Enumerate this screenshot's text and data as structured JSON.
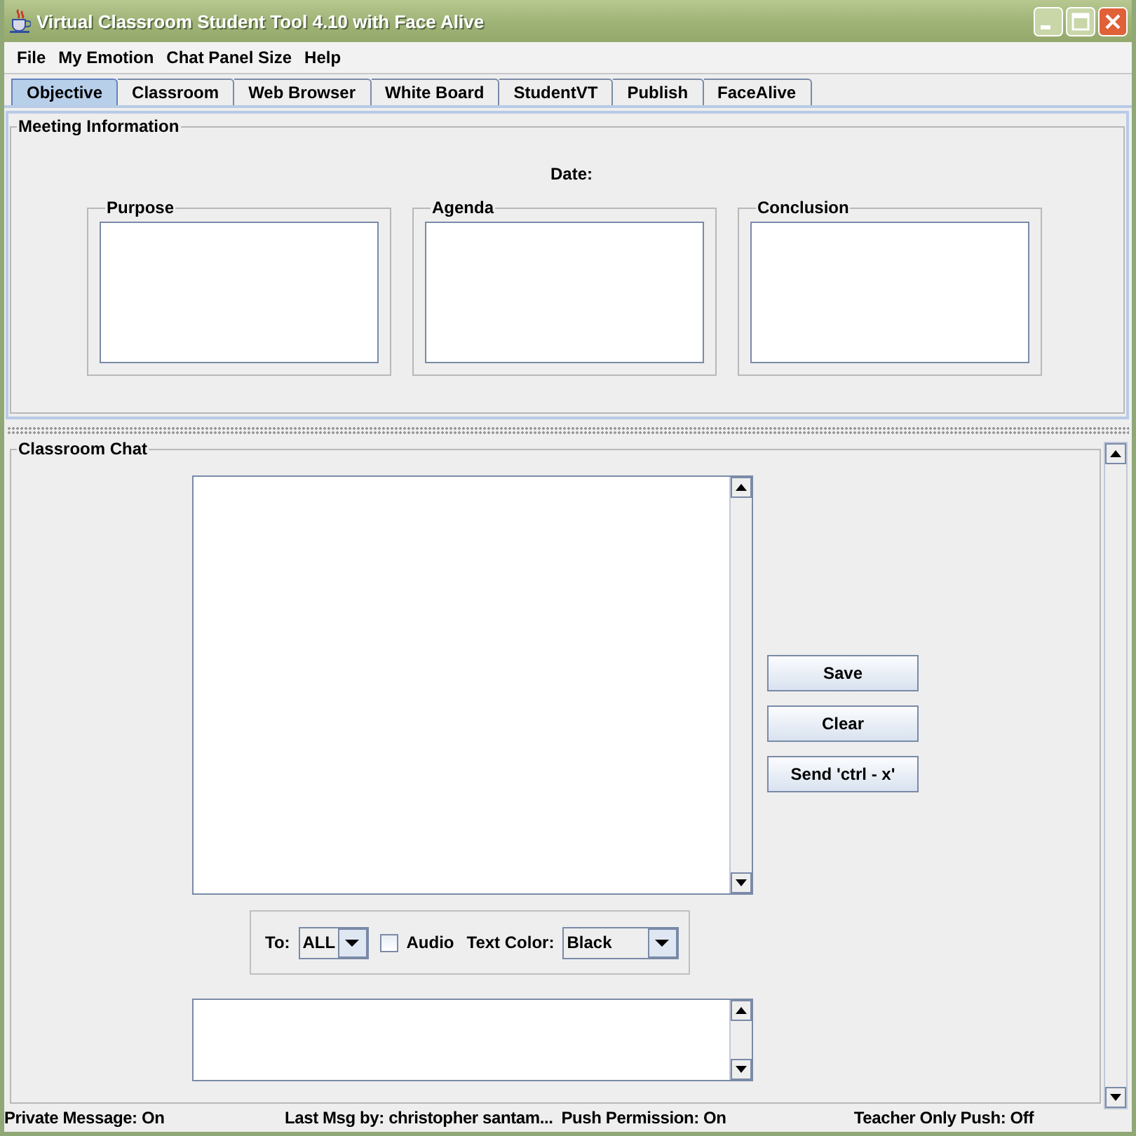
{
  "window": {
    "title": "Virtual Classroom Student Tool 4.10 with Face Alive"
  },
  "menu": [
    "File",
    "My Emotion",
    "Chat Panel Size",
    "Help"
  ],
  "tabs": [
    {
      "label": "Objective",
      "selected": true
    },
    {
      "label": "Classroom",
      "selected": false
    },
    {
      "label": "Web Browser",
      "selected": false
    },
    {
      "label": "White Board",
      "selected": false
    },
    {
      "label": "StudentVT",
      "selected": false
    },
    {
      "label": "Publish",
      "selected": false
    },
    {
      "label": "FaceAlive",
      "selected": false
    }
  ],
  "meeting_information": {
    "title": "Meeting Information",
    "date_label": "Date:",
    "sections": [
      "Purpose",
      "Agenda",
      "Conclusion"
    ]
  },
  "classroom_chat": {
    "title": "Classroom Chat",
    "buttons": [
      "Save",
      "Clear",
      "Send 'ctrl - x'"
    ],
    "to_label": "To:",
    "to_value": "ALL",
    "audio": {
      "label": "Audio",
      "checked": false
    },
    "text_color_label": "Text Color:",
    "text_color_value": "Black"
  },
  "status_bar": [
    "Private Message: On",
    "Last Msg by: christopher santam...",
    "Push Permission: On",
    "Teacher Only Push: Off"
  ]
}
